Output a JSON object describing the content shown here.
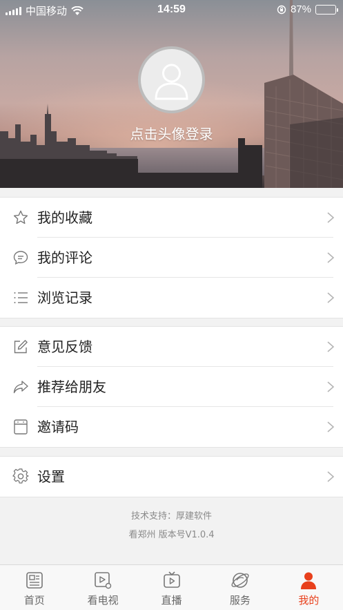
{
  "status_bar": {
    "carrier": "中国移动",
    "time": "14:59",
    "battery_percent": "87%",
    "battery_level": 0.87
  },
  "profile": {
    "login_prompt": "点击头像登录"
  },
  "menu_group_1": [
    {
      "label": "我的收藏",
      "icon": "star-icon"
    },
    {
      "label": "我的评论",
      "icon": "comment-icon"
    },
    {
      "label": "浏览记录",
      "icon": "list-icon"
    }
  ],
  "menu_group_2": [
    {
      "label": "意见反馈",
      "icon": "edit-icon"
    },
    {
      "label": "推荐给朋友",
      "icon": "share-icon"
    },
    {
      "label": "邀请码",
      "icon": "invite-code-icon"
    }
  ],
  "menu_group_3": [
    {
      "label": "设置",
      "icon": "gear-icon"
    }
  ],
  "footer": {
    "support": "技术支持：厚建软件",
    "version": "看郑州  版本号V1.0.4"
  },
  "tabbar": {
    "tabs": [
      {
        "label": "首页",
        "icon": "news-icon"
      },
      {
        "label": "看电视",
        "icon": "tv-video-icon"
      },
      {
        "label": "直播",
        "icon": "live-tv-icon"
      },
      {
        "label": "服务",
        "icon": "planet-icon"
      },
      {
        "label": "我的",
        "icon": "user-icon"
      }
    ],
    "active_index": 4,
    "accent_color": "#e8401c"
  }
}
